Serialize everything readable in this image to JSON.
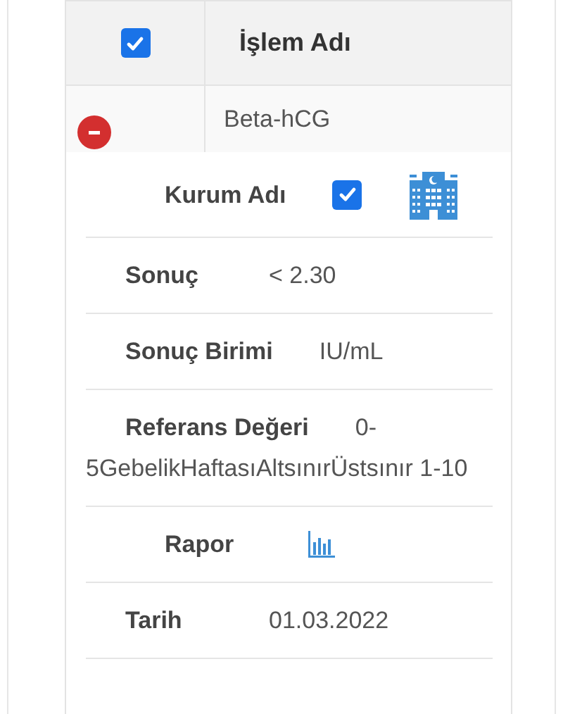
{
  "header": {
    "select_all": {
      "checked": true
    },
    "column_title": "İşlem Adı"
  },
  "row": {
    "expanded": true,
    "name": "Beta-hCG"
  },
  "details": [
    {
      "kind": "checkbox",
      "label": "Kurum Adı",
      "checked": true
    },
    {
      "kind": "text",
      "label": "Sonuç",
      "value": "< 2.30"
    },
    {
      "kind": "text",
      "label": "Sonuç Birimi",
      "value": "IU/mL"
    },
    {
      "kind": "text",
      "label": "Referans Değeri",
      "value": "0-5GebelikHaftasıAltsınırÜstsınır 1-10"
    },
    {
      "kind": "report",
      "label": "Rapor"
    },
    {
      "kind": "text",
      "label": "Tarih",
      "value": "01.03.2022"
    }
  ]
}
